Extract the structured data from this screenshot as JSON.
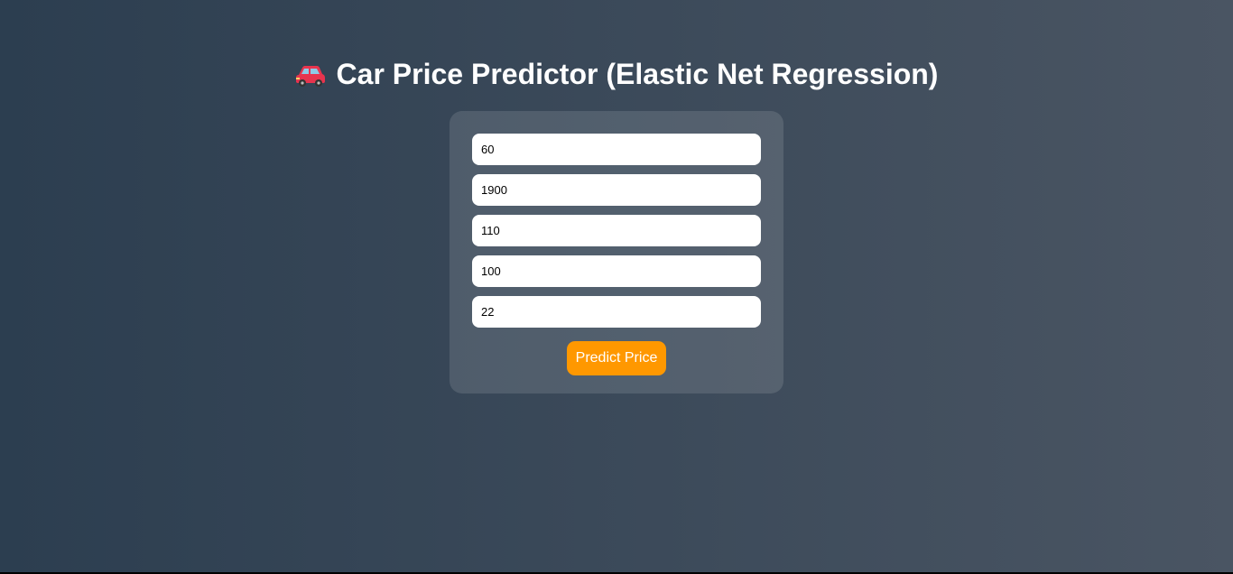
{
  "header": {
    "icon": "car-icon",
    "title": "Car Price Predictor (Elastic Net Regression)"
  },
  "form": {
    "fields": [
      {
        "value": "60"
      },
      {
        "value": "1900"
      },
      {
        "value": "110"
      },
      {
        "value": "100"
      },
      {
        "value": "22"
      }
    ],
    "submit_label": "Predict Price"
  },
  "colors": {
    "background_start": "#2c3e50",
    "background_end": "#4a5563",
    "button": "#ff9800"
  }
}
